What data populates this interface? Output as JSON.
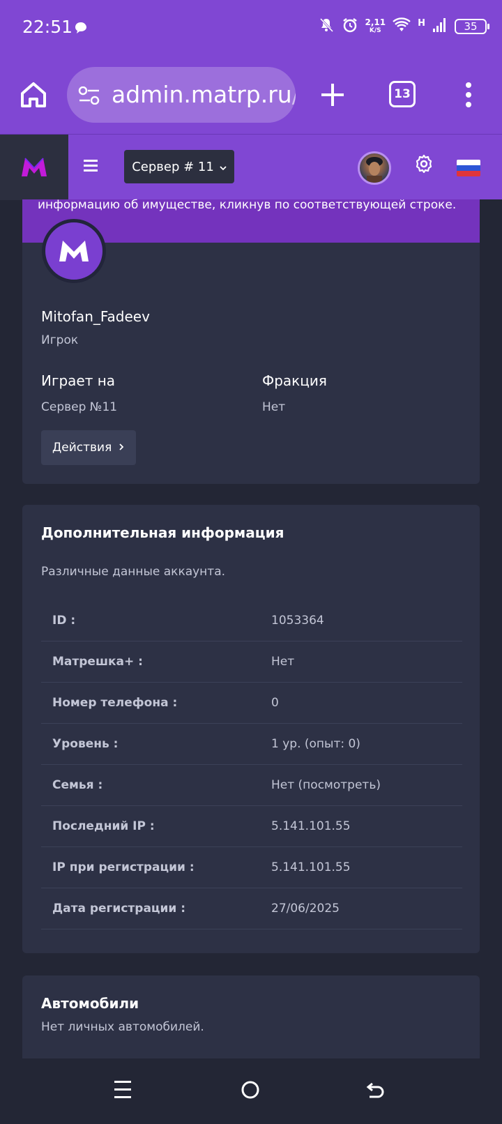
{
  "status_bar": {
    "time": "22:51",
    "net_speed_value": "2,11",
    "net_speed_unit": "K/S",
    "network_type": "H",
    "battery": "35"
  },
  "browser": {
    "url_main": "admin.matrp.ru",
    "url_rest": "/|",
    "tab_count": "13"
  },
  "site_header": {
    "server_label": "Сервер # 11",
    "flag_colors": [
      "#ffffff",
      "#2d55d6",
      "#e0353b"
    ]
  },
  "profile": {
    "hint": "информацию об имуществе, кликнув по соответствующей строке.",
    "name": "Mitofan_Fadeev",
    "role": "Игрок",
    "plays_on_label": "Играет на",
    "plays_on_value": "Сервер №11",
    "faction_label": "Фракция",
    "faction_value": "Нет",
    "actions_label": "Действия"
  },
  "info": {
    "title": "Дополнительная информация",
    "subtitle": "Различные данные аккаунта.",
    "rows": [
      {
        "key": "ID :",
        "value": "1053364"
      },
      {
        "key": "Матрешка+ :",
        "value": "Нет"
      },
      {
        "key": "Номер телефона :",
        "value": "0"
      },
      {
        "key": "Уровень :",
        "value": "1 ур. (опыт: 0)"
      },
      {
        "key": "Семья :",
        "value": "Нет (посмотреть)"
      },
      {
        "key": "Последний IP :",
        "value": "5.141.101.55"
      },
      {
        "key": "IP при регистрации :",
        "value": "5.141.101.55"
      },
      {
        "key": "Дата регистрации :",
        "value": "27/06/2025"
      }
    ]
  },
  "cars": {
    "title": "Автомобили",
    "text": "Нет личных автомобилей."
  },
  "colors": {
    "accent": "#8047d3",
    "card": "#2d3145",
    "background": "#232635"
  }
}
